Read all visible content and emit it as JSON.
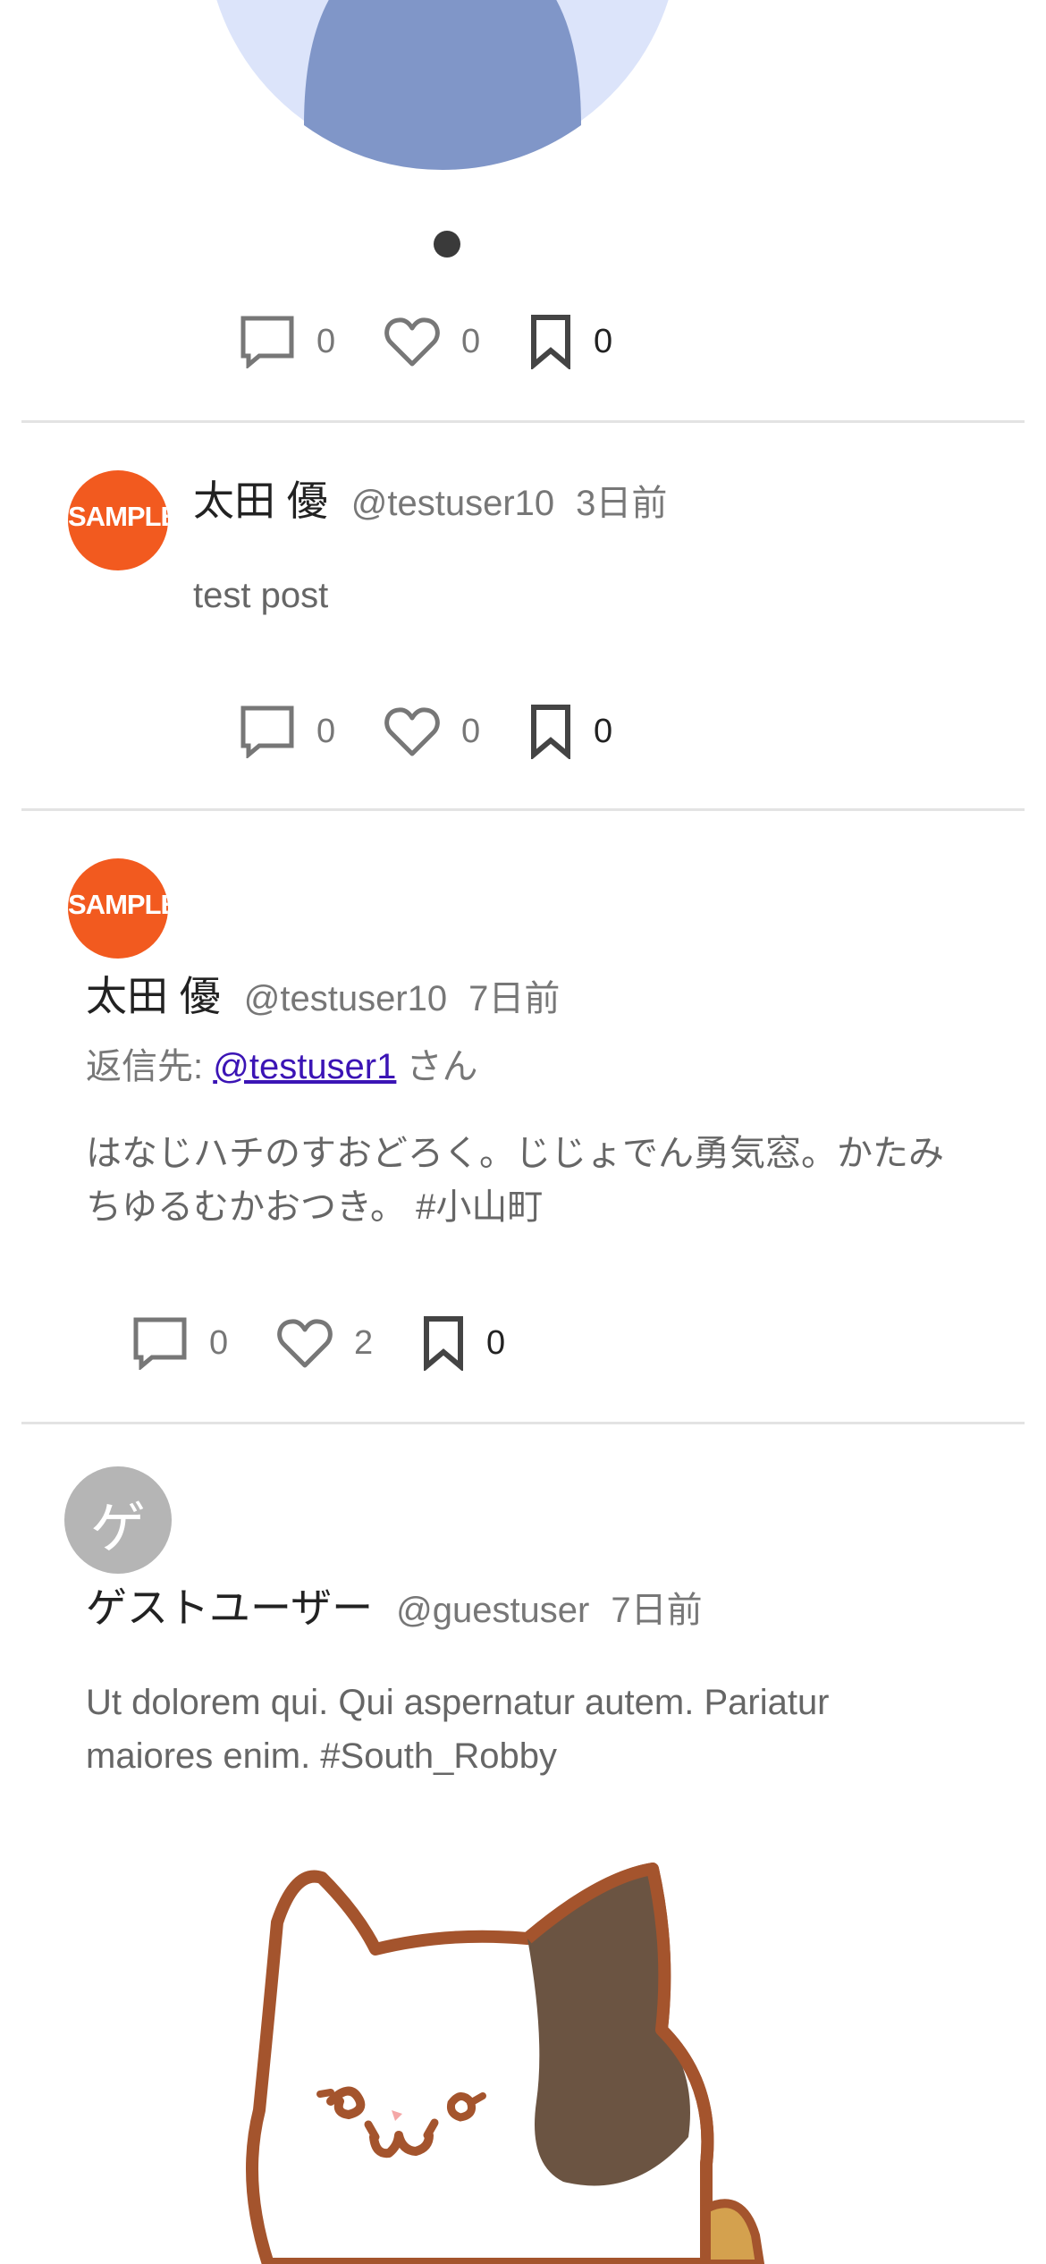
{
  "top_post": {
    "carousel": {
      "dot_count": 1,
      "active_index": 0
    },
    "actions": {
      "replies": "0",
      "likes": "0",
      "bookmarks": "0"
    }
  },
  "posts": [
    {
      "display_name": "太田 優",
      "username": "@testuser10",
      "timestamp": "3日前",
      "avatar_text": "SAMPLE",
      "text": "test post",
      "actions": {
        "replies": "0",
        "likes": "0",
        "bookmarks": "0"
      }
    },
    {
      "display_name": "太田 優",
      "username": "@testuser10",
      "timestamp": "7日前",
      "avatar_text": "SAMPLE",
      "reply_prefix": "返信先: ",
      "reply_target": "@testuser1",
      "reply_suffix": " さん",
      "text_line1": "はなじハチのすおどろく。じじょでん勇気窓。かたみ",
      "text_line2": "ちゆるむかおつき。 #小山町",
      "actions": {
        "replies": "0",
        "likes": "2",
        "bookmarks": "0"
      }
    },
    {
      "display_name": "ゲストユーザー",
      "username": "@guestuser",
      "timestamp": "7日前",
      "avatar_text": "ゲ",
      "text_line1": "Ut dolorem qui. Qui aspernatur autem. Pariatur",
      "text_line2": "maiores enim. #South_Robby",
      "image_icon": "cat-illustration"
    }
  ],
  "colors": {
    "sample_avatar": "#f25a1f",
    "guest_avatar": "#b5b5b5",
    "link": "#3b14b5",
    "divider": "#e3e3e3"
  }
}
